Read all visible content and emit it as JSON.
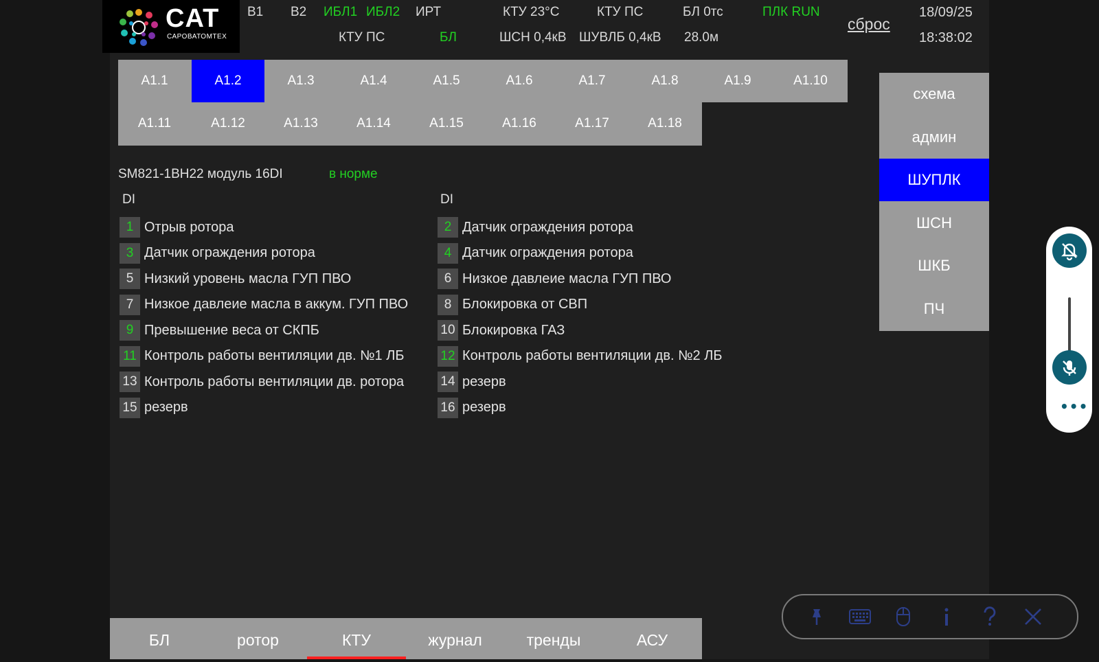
{
  "logo": {
    "title": "CAT",
    "subtitle": "САРОВАТОМТЕХ"
  },
  "header": {
    "row1": [
      "В1",
      "В2",
      "ИБЛ1",
      "ИБЛ2",
      "ИРТ",
      "КТУ 23°С",
      "КТУ ПС",
      "БЛ 0тс",
      "ПЛК RUN"
    ],
    "row2": [
      "КТУ ПС",
      "БЛ",
      "ШСН 0,4кВ",
      "ШУВЛБ 0,4кВ",
      "28.0м"
    ],
    "reset_label": "сброс",
    "date": "18/09/25",
    "time": "18:38:02",
    "green_color": "#22d022"
  },
  "tabs": {
    "row1": [
      "A1.1",
      "A1.2",
      "A1.3",
      "A1.4",
      "A1.5",
      "A1.6",
      "A1.7",
      "A1.8",
      "A1.9",
      "A1.10"
    ],
    "row2": [
      "A1.11",
      "A1.12",
      "A1.13",
      "A1.14",
      "A1.15",
      "A1.16",
      "A1.17",
      "A1.18"
    ],
    "active": "A1.2"
  },
  "module": {
    "title": "SM821-1BH22 модуль 16DI",
    "status": "в норме",
    "col_header_left": "DI",
    "col_header_right": "DI",
    "inputs": [
      {
        "num": "1",
        "label": "Отрыв ротора",
        "on": true
      },
      {
        "num": "2",
        "label": "Датчик ограждения ротора",
        "on": true
      },
      {
        "num": "3",
        "label": "Датчик ограждения ротора",
        "on": true
      },
      {
        "num": "4",
        "label": "Датчик ограждения ротора",
        "on": true
      },
      {
        "num": "5",
        "label": "Низкий уровень масла ГУП ПВО",
        "on": false
      },
      {
        "num": "6",
        "label": "Низкое давлеие масла ГУП ПВО",
        "on": false
      },
      {
        "num": "7",
        "label": "Низкое давлеие масла в аккум. ГУП ПВО",
        "on": false
      },
      {
        "num": "8",
        "label": "Блокировка от СВП",
        "on": false
      },
      {
        "num": "9",
        "label": "Превышение веса от СКПБ",
        "on": true
      },
      {
        "num": "10",
        "label": "Блокировка ГАЗ",
        "on": false
      },
      {
        "num": "11",
        "label": "Контроль работы вентиляции дв. №1 ЛБ",
        "on": true
      },
      {
        "num": "12",
        "label": "Контроль работы вентиляции дв. №2 ЛБ",
        "on": true
      },
      {
        "num": "13",
        "label": "Контроль работы вентиляции дв. ротора",
        "on": false
      },
      {
        "num": "14",
        "label": "резерв",
        "on": false
      },
      {
        "num": "15",
        "label": "резерв",
        "on": false
      },
      {
        "num": "16",
        "label": "резерв",
        "on": false
      }
    ]
  },
  "side_menu": {
    "items": [
      "схема",
      "админ",
      "ШУПЛК",
      "ШСН",
      "ШКБ",
      "ПЧ"
    ],
    "active": "ШУПЛК"
  },
  "bottom_nav": {
    "items": [
      "БЛ",
      "ротор",
      "КТУ",
      "журнал",
      "тренды",
      "АСУ"
    ],
    "active": "КТУ"
  },
  "floating_widget": {
    "icons": [
      "bell-off-icon",
      "mic-off-icon",
      "more-icon"
    ],
    "more_glyph": "•••"
  },
  "floating_toolbar": {
    "icons": [
      "pin-icon",
      "keyboard-icon",
      "mouse-icon",
      "info-icon",
      "help-icon",
      "close-icon"
    ]
  }
}
